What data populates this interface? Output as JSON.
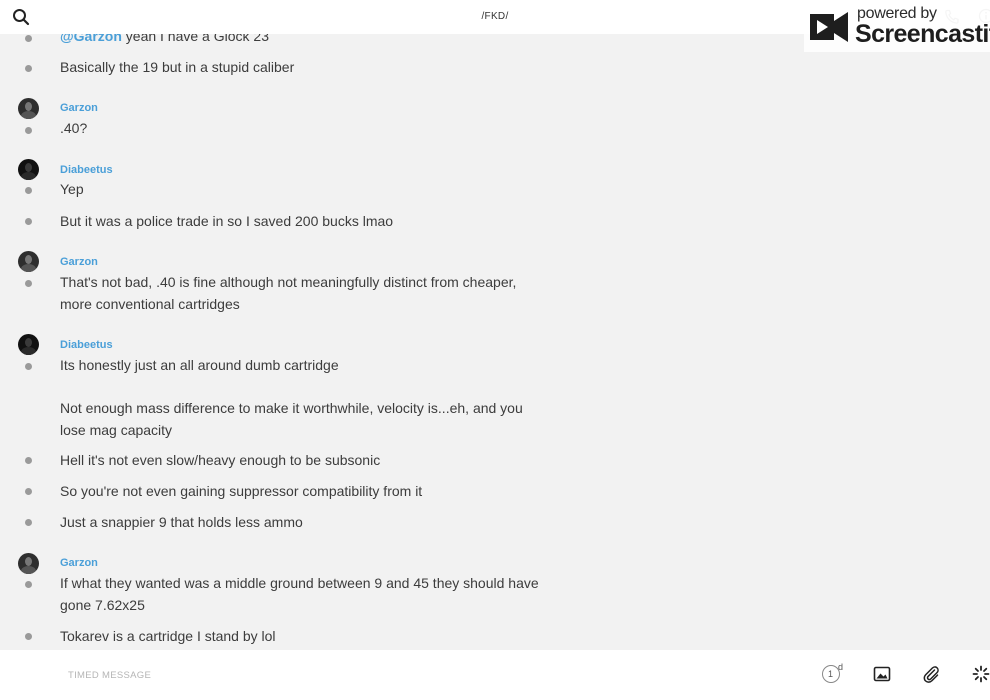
{
  "header": {
    "title": "/FKD/"
  },
  "watermark": {
    "powered": "powered by",
    "brand": "Screencastify"
  },
  "messages": [
    {
      "text_prefix": "@Garzon",
      "text": " yeah I have a Glock 23"
    },
    {
      "text": "Basically the 19 but in a stupid caliber"
    },
    {
      "author": "Garzon",
      "text": ".40?"
    },
    {
      "author": "Diabeetus",
      "text": "Yep"
    },
    {
      "text": "But it was a police trade in so I saved 200 bucks lmao"
    },
    {
      "author": "Garzon",
      "text_line1": "That's not bad, .40 is fine although not meaningfully distinct from cheaper,",
      "text_line2": "more conventional cartridges"
    },
    {
      "author": "Diabeetus",
      "text": "Its honestly just an all around dumb cartridge",
      "text_p2_line1": "Not enough mass difference to make it worthwhile, velocity is...eh, and you",
      "text_p2_line2": "lose mag capacity"
    },
    {
      "text": "Hell it's not even slow/heavy enough to be subsonic"
    },
    {
      "text": "So you're not even gaining suppressor compatibility from it"
    },
    {
      "text": "Just a snappier 9 that holds less ammo"
    },
    {
      "author": "Garzon",
      "text_line1": "If what they wanted was a middle ground between 9 and 45 they should have",
      "text_line2": "gone 7.62x25"
    },
    {
      "text": "Tokarev is a cartridge I stand by lol"
    }
  ],
  "composer": {
    "placeholder": "TIMED MESSAGE",
    "timer_value": "1",
    "timer_unit": "d"
  },
  "icons": {
    "search": "search-icon",
    "phone": "phone-icon",
    "info": "info-icon",
    "timer": "timer-icon",
    "image": "image-icon",
    "attach": "paperclip-icon",
    "loading": "spinner-icon"
  },
  "colors": {
    "accent": "#4a9fd8",
    "background": "#f2f2f2"
  }
}
